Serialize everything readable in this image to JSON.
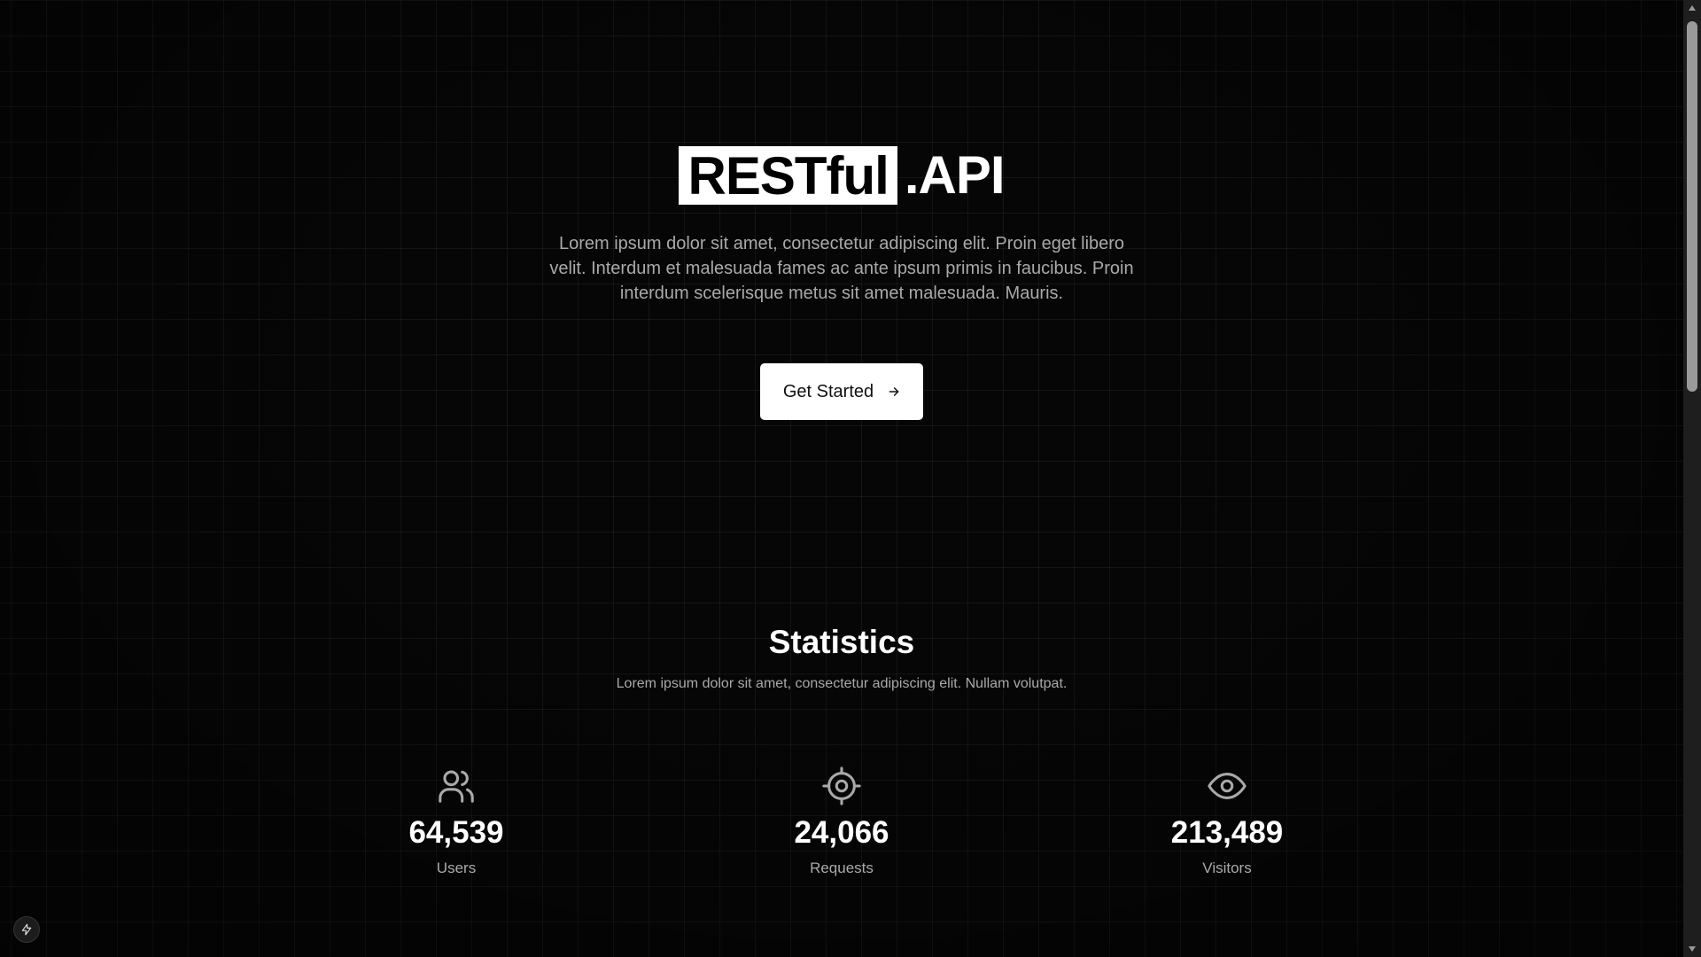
{
  "hero": {
    "brand_highlight": "RESTful",
    "brand_rest": ".API",
    "description": "Lorem ipsum dolor sit amet, consectetur adipiscing elit. Proin eget libero velit. Interdum et malesuada fames ac ante ipsum primis in faucibus. Proin interdum scelerisque metus sit amet malesuada. Mauris.",
    "cta_label": "Get Started",
    "cta_icon": "arrow-right-icon"
  },
  "statistics": {
    "title": "Statistics",
    "description": "Lorem ipsum dolor sit amet, consectetur adipiscing elit. Nullam volutpat.",
    "items": [
      {
        "icon": "users-icon",
        "value": "64,539",
        "label": "Users"
      },
      {
        "icon": "target-icon",
        "value": "24,066",
        "label": "Requests"
      },
      {
        "icon": "eye-icon",
        "value": "213,489",
        "label": "Visitors"
      }
    ]
  },
  "floating_button": {
    "icon": "bolt-icon"
  },
  "colors": {
    "background": "#060606",
    "grid_line": "#1a1a1a",
    "text_primary": "#ffffff",
    "text_muted": "#a9a9a9",
    "button_bg": "#ffffff",
    "button_text": "#111111",
    "scrollbar_track": "#1e1e1e",
    "scrollbar_thumb": "#9a9a9a"
  }
}
